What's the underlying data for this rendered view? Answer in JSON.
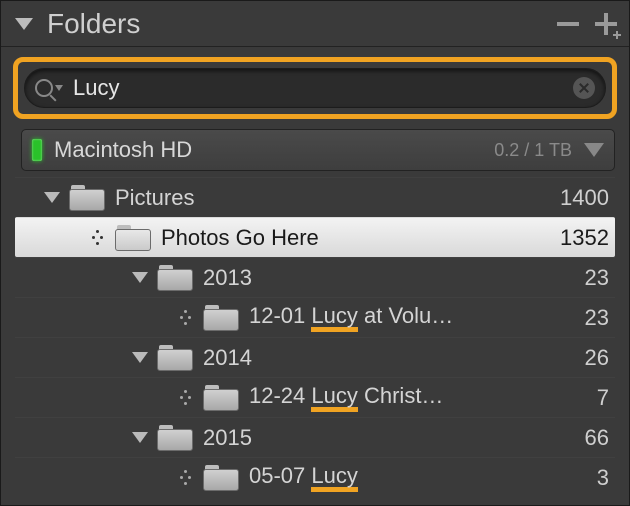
{
  "panel": {
    "title": "Folders"
  },
  "search": {
    "value": "Lucy"
  },
  "volume": {
    "name": "Macintosh HD",
    "capacity": "0.2 / 1 TB"
  },
  "tree": {
    "pictures": {
      "label": "Pictures",
      "count": "1400"
    },
    "photos": {
      "label": "Photos Go Here",
      "count": "1352"
    },
    "y2013": {
      "label": "2013",
      "count": "23"
    },
    "y2013a": {
      "pre": "12-01 ",
      "hit": "Lucy",
      "post": " at Volu…",
      "count": "23"
    },
    "y2014": {
      "label": "2014",
      "count": "26"
    },
    "y2014a": {
      "pre": "12-24 ",
      "hit": "Lucy",
      "post": " Christ…",
      "count": "7"
    },
    "y2015": {
      "label": "2015",
      "count": "66"
    },
    "y2015a": {
      "pre": "05-07 ",
      "hit": "Lucy",
      "post": "",
      "count": "3"
    }
  }
}
